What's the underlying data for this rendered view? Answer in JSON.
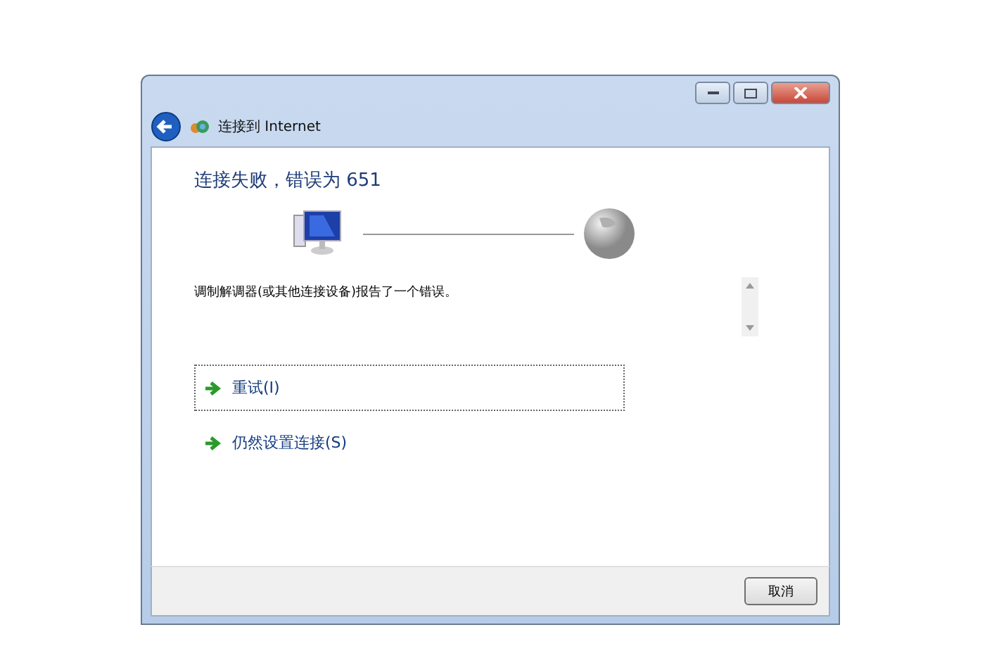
{
  "window": {
    "title": "连接到 Internet"
  },
  "heading": "连接失败，错误为 651",
  "message": "调制解调器(或其他连接设备)报告了一个错误。",
  "options": [
    {
      "label": "重试(I)",
      "selected": true
    },
    {
      "label": "仍然设置连接(S)",
      "selected": false
    }
  ],
  "buttons": [
    "取消"
  ]
}
